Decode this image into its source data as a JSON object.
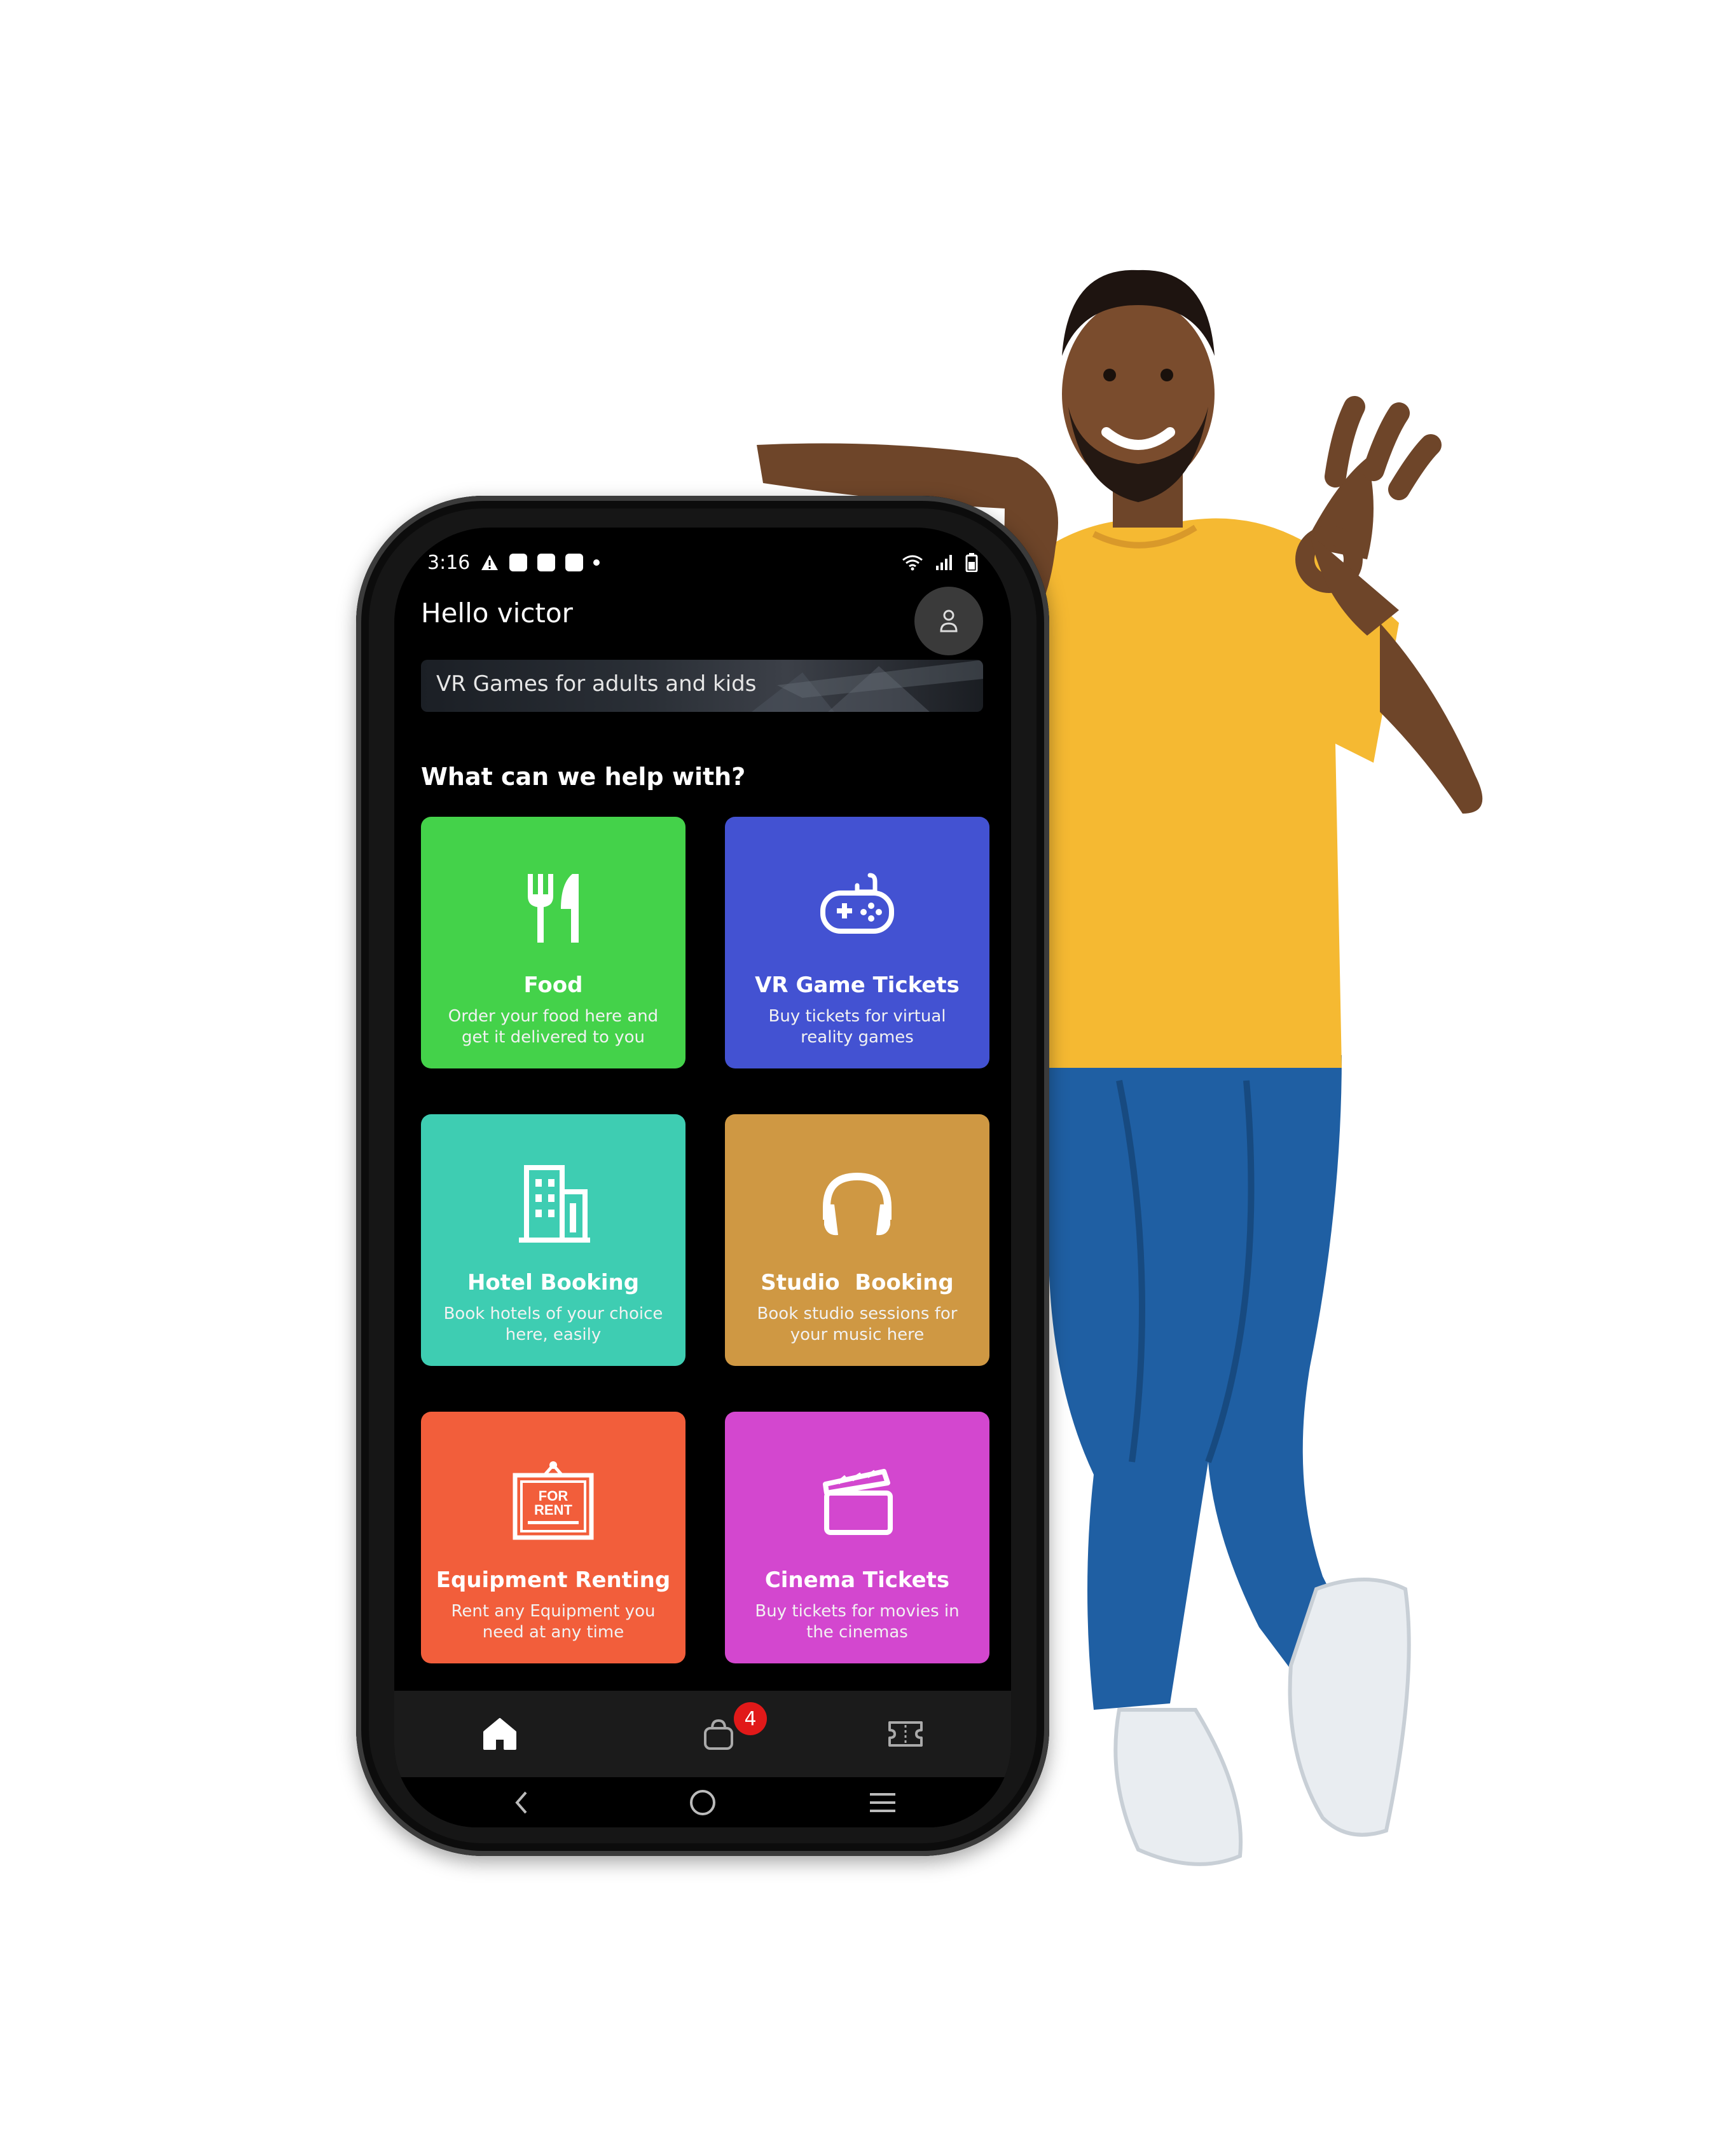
{
  "status_bar": {
    "time": "3:16"
  },
  "header": {
    "greeting": "Hello victor"
  },
  "banner": {
    "text": "VR Games for adults and kids"
  },
  "section": {
    "title": "What can we help with?"
  },
  "services": [
    {
      "title": "Food",
      "description": "Order your food here and get it delivered to you",
      "color": "#44d24a",
      "icon": "fork-knife-icon"
    },
    {
      "title": "VR Game Tickets",
      "description": "Buy tickets for virtual reality games",
      "color": "#4352d2",
      "icon": "gamepad-icon"
    },
    {
      "title": "Hotel Booking",
      "description": "Book hotels of your choice here, easily",
      "color": "#3ecdb2",
      "icon": "building-icon"
    },
    {
      "title": "Studio  Booking",
      "description": "Book studio sessions for your music here",
      "color": "#cf9843",
      "icon": "headphones-icon"
    },
    {
      "title": "Equipment Renting",
      "description": "Rent any Equipment you need at any time",
      "color": "#f25e3b",
      "icon": "for-rent-sign-icon",
      "sign_text": "FOR RENT"
    },
    {
      "title": "Cinema Tickets",
      "description": "Buy tickets for movies in the cinemas",
      "color": "#d347cf",
      "icon": "clapperboard-icon"
    }
  ],
  "bottom_nav": {
    "cart_badge": "4"
  }
}
